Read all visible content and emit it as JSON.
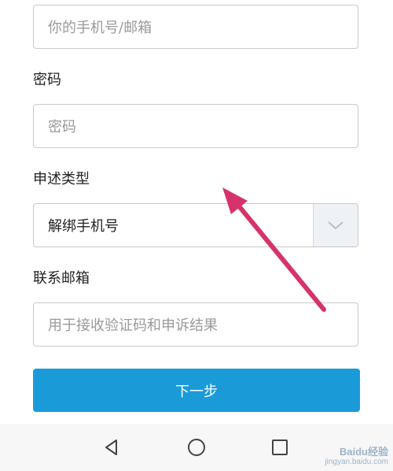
{
  "form": {
    "account_field": {
      "placeholder": "你的手机号/邮箱"
    },
    "password": {
      "label": "密码",
      "placeholder": "密码"
    },
    "appeal_type": {
      "label": "申述类型",
      "value": "解绑手机号"
    },
    "contact_email": {
      "label": "联系邮箱",
      "placeholder": "用于接收验证码和申诉结果"
    },
    "next_button": {
      "label": "下一步"
    }
  },
  "navbar": {
    "icons": [
      "back-triangle",
      "home-circle",
      "recents-square"
    ]
  },
  "annotation": {
    "arrow_color": "#d6336c"
  },
  "watermark": {
    "main": "Baidu经验",
    "sub": "jingyan.baidu.com"
  },
  "colors": {
    "accent": "#1a9bd7",
    "border": "#c9c9c9",
    "placeholder": "#9a9a9a"
  }
}
